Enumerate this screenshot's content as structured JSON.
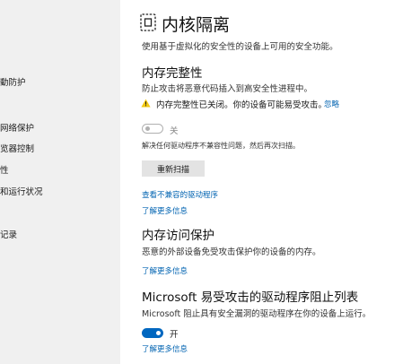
{
  "sidebar": {
    "items": [
      {
        "label": "動防护"
      },
      {
        "label": "网络保护"
      },
      {
        "label": "览器控制"
      },
      {
        "label": "性"
      },
      {
        "label": "和运行状况"
      },
      {
        "label": "记录"
      }
    ]
  },
  "page": {
    "title": "内核隔离",
    "icon": "core-isolation-icon",
    "description": "使用基于虚拟化的安全性的设备上可用的安全功能。"
  },
  "memory_integrity": {
    "heading": "内存完整性",
    "description": "防止攻击将恶意代码插入到高安全性进程中。",
    "warning": "内存完整性已关闭。你的设备可能易受攻击。",
    "dismiss_label": "忽略",
    "toggle_label": "关",
    "toggle_state": "off",
    "note": "解决任何驱动程序不兼容性问题，然后再次扫描。",
    "rescan_label": "重新扫描",
    "incompatible_link": "查看不兼容的驱动程序",
    "learn_more": "了解更多信息"
  },
  "memory_access": {
    "heading": "内存访问保护",
    "description": "恶意的外部设备免受攻击保护你的设备的内存。",
    "learn_more": "了解更多信息"
  },
  "driver_blocklist": {
    "heading": "Microsoft 易受攻击的驱动程序阻止列表",
    "description": "Microsoft 阻止具有安全漏洞的驱动程序在你的设备上运行。",
    "toggle_label": "开",
    "toggle_state": "on",
    "learn_more": "了解更多信息"
  },
  "colors": {
    "accent": "#0067c0",
    "link": "#0063b1",
    "warning": "#f2c811",
    "sidebar_bg": "#f0f0f0"
  }
}
